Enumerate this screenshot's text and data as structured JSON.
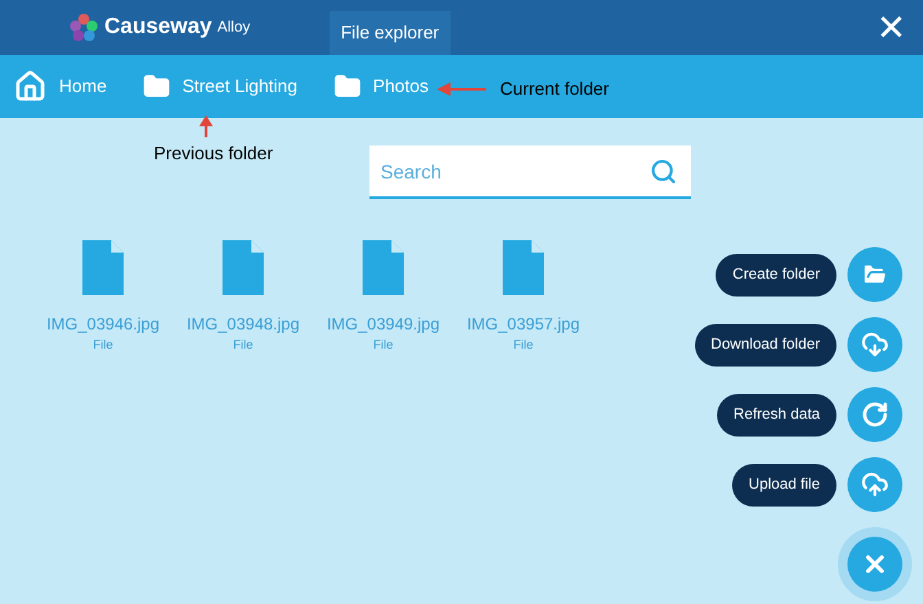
{
  "header": {
    "logo_text": "Causeway",
    "logo_suffix": "Alloy",
    "tab": "File explorer",
    "close": "✕"
  },
  "breadcrumbs": [
    {
      "kind": "home",
      "label": "Home"
    },
    {
      "kind": "folder",
      "label": "Street Lighting"
    },
    {
      "kind": "folder",
      "label": "Photos"
    }
  ],
  "annotations": [
    {
      "kind": "left",
      "label": "Current folder"
    },
    {
      "kind": "up",
      "label": "Previous folder"
    }
  ],
  "search": {
    "placeholder": "Search"
  },
  "files": [
    {
      "name": "IMG_03946.jpg",
      "type": "File"
    },
    {
      "name": "IMG_03948.jpg",
      "type": "File"
    },
    {
      "name": "IMG_03949.jpg",
      "type": "File"
    },
    {
      "name": "IMG_03957.jpg",
      "type": "File"
    }
  ],
  "actions": [
    {
      "kind": "folder",
      "label": "Create folder"
    },
    {
      "kind": "download",
      "label": "Download folder"
    },
    {
      "kind": "refresh",
      "label": "Refresh data"
    },
    {
      "kind": "upload",
      "label": "Upload file"
    }
  ]
}
